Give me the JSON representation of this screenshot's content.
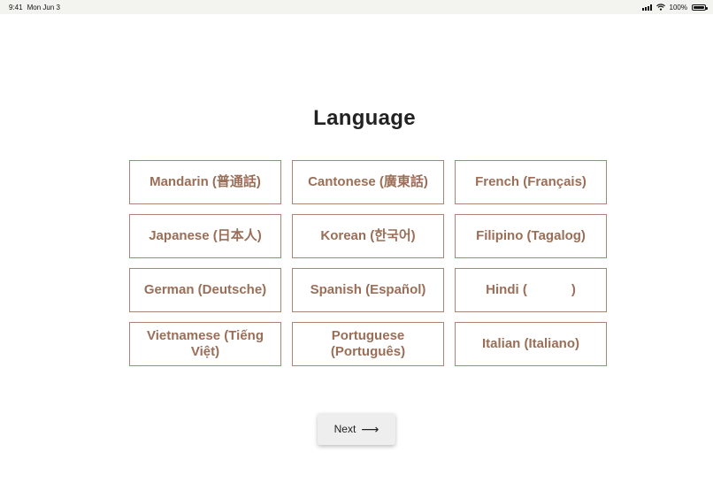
{
  "status_bar": {
    "time": "9:41",
    "date": "Mon Jun 3",
    "battery": "100%"
  },
  "title": "Language",
  "languages": [
    "Mandarin (普通話)",
    "Cantonese (廣東話)",
    "French (Français)",
    "Japanese (日本人)",
    "Korean (한국어)",
    "Filipino (Tagalog)",
    "German (Deutsche)",
    "Spanish (Español)",
    "Hindi (            )",
    "Vietnamese (Tiếng Việt)",
    "Portuguese (Português)",
    "Italian (Italiano)"
  ],
  "next_button": {
    "label": "Next",
    "icon": "arrow-right-icon"
  }
}
